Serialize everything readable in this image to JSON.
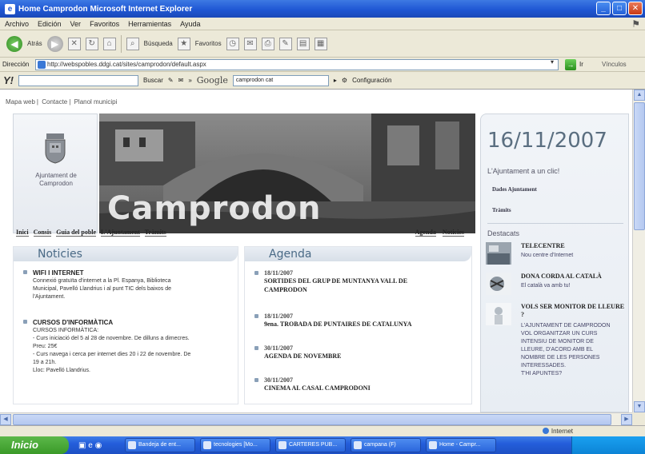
{
  "window": {
    "title": "Home   Camprodon   Microsoft Internet Explorer"
  },
  "menu": [
    "Archivo",
    "Edición",
    "Ver",
    "Favoritos",
    "Herramientas",
    "Ayuda"
  ],
  "toolbar": {
    "back_label": "Atrás",
    "search_label": "Búsqueda",
    "favorites_label": "Favoritos"
  },
  "address": {
    "label": "Dirección",
    "url": "http://webspobles.ddgi.cat/sites/camprodon/default.aspx",
    "go_label": "Ir",
    "links_label": "Vínculos"
  },
  "searchbar": {
    "search_label": "Buscar",
    "google_label": "Google",
    "google_query": "camprodon cat",
    "settings_label": "Configuración"
  },
  "page": {
    "topnav": [
      "Mapa web",
      "Contacte",
      "Planol municipi"
    ],
    "logo_text": [
      "Ajuntament de",
      "Camprodon"
    ],
    "banner_title": "Camprodon",
    "nav_left": [
      "Inici",
      "Consis",
      "Guia del poble",
      "L'Ajuntament",
      "Tràmits"
    ],
    "nav_right": [
      "Agenda",
      "Noticies"
    ],
    "noticies": {
      "heading": "Noticies",
      "items": [
        {
          "title": "WIFI I INTERNET",
          "body": [
            "Connexió gratuïta d'internet a la Pl. Espanya, Biblioteca",
            "Municipal, Pavelló Llandrius i al punt TIC dels baixos de",
            "l'Ajuntament."
          ]
        },
        {
          "title": "CURSOS D'INFORMÀTICA",
          "body": [
            "CURSOS  INFORMÀTICA:",
            "- Curs iniciació del 5 al 28 de novembre. De dilluns a dimecres.",
            "Preu: 25€",
            "- Curs navega i cerca per internet dies 20 i 22 de novembre. De",
            "19 a 21h.",
            "Lloc: Pavelló Llandrius."
          ]
        }
      ]
    },
    "agenda": {
      "heading": "Agenda",
      "items": [
        {
          "date": "18/11/2007",
          "event": [
            "SORTIDES DEL GRUP DE MUNTANYA VALL DE",
            "CAMPRODON"
          ]
        },
        {
          "date": "18/11/2007",
          "event": [
            "9ena. TROBADA DE PUNTAIRES DE CATALUNYA"
          ]
        },
        {
          "date": "30/11/2007",
          "event": [
            "AGENDA DE NOVEMBRE"
          ]
        },
        {
          "date": "30/11/2007",
          "event": [
            "CINEMA AL CASAL CAMPRODONI"
          ]
        }
      ]
    },
    "sidebar": {
      "date": "16/11/2007",
      "ajuntament_heading": "L'Ajuntament a un clic!",
      "links": [
        "Dades Ajuntament",
        "Tràmits"
      ],
      "destacats_heading": "Destacats",
      "destacats": [
        {
          "title": "TELECENTRE",
          "sub": [
            "Nou centre d'Internet"
          ]
        },
        {
          "title": "DONA CORDA AL CATALÀ",
          "sub": [
            "El català va amb tu!"
          ]
        },
        {
          "title": "VOLS SER MONITOR DE LLEURE ?",
          "sub": [
            "L'AJUNTAMENT DE CAMPRODON",
            "VOL ORGANITZAR UN CURS",
            "INTENSIU DE MONITOR DE",
            "LLEURE, D'ACORD AMB EL",
            "NOMBRE DE LES PERSONES",
            "INTERESSADES.",
            "T'HI APUNTES?"
          ]
        }
      ]
    }
  },
  "status": {
    "zone": "Internet"
  },
  "taskbar": {
    "start_label": "Inicio",
    "tasks": [
      "Bandeja de ent...",
      "tecnologies [Mo...",
      "CARTERES PUB...",
      "campana (F)",
      "Home - Campr..."
    ]
  },
  "colors": {
    "titlebar": "#245edb",
    "heading_blue": "#4a6a86",
    "date_color": "#5a6e80"
  }
}
